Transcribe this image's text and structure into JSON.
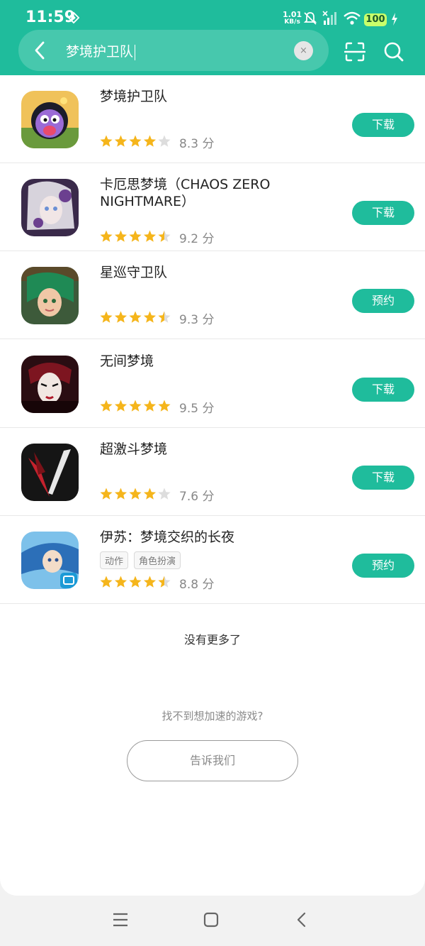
{
  "status": {
    "time": "11:59",
    "net_value": "1.01",
    "net_unit": "KB/s",
    "battery": "100"
  },
  "search": {
    "query": "梦境护卫队",
    "clear_label": "×"
  },
  "results": [
    {
      "name": "梦境护卫队",
      "tags": [],
      "rating": 4,
      "score": "8.3 分",
      "action": "下载",
      "icon": "purple-monster-icon"
    },
    {
      "name": "卡厄思梦境（CHAOS ZERO NIGHTMARE）",
      "tags": [],
      "rating": 4.5,
      "score": "9.2 分",
      "action": "下载",
      "icon": "anime-girl-icon"
    },
    {
      "name": "星巡守卫队",
      "tags": [],
      "rating": 4.5,
      "score": "9.3 分",
      "action": "预约",
      "icon": "green-hair-hero-icon"
    },
    {
      "name": "无间梦境",
      "tags": [],
      "rating": 5,
      "score": "9.5 分",
      "action": "下载",
      "icon": "opera-mask-icon"
    },
    {
      "name": "超激斗梦境",
      "tags": [],
      "rating": 4,
      "score": "7.6 分",
      "action": "下载",
      "icon": "slash-logo-icon"
    },
    {
      "name": "伊苏：梦境交织的长夜",
      "tags": [
        "动作",
        "角色扮演"
      ],
      "rating": 4.5,
      "score": "8.8 分",
      "action": "预约",
      "icon": "blue-hero-icon"
    }
  ],
  "footer": {
    "no_more": "没有更多了",
    "hint": "找不到想加速的游戏?",
    "tell_us": "告诉我们"
  },
  "colors": {
    "accent": "#1fbc9c",
    "star": "#f5b51b",
    "star_empty": "#dddddd"
  }
}
